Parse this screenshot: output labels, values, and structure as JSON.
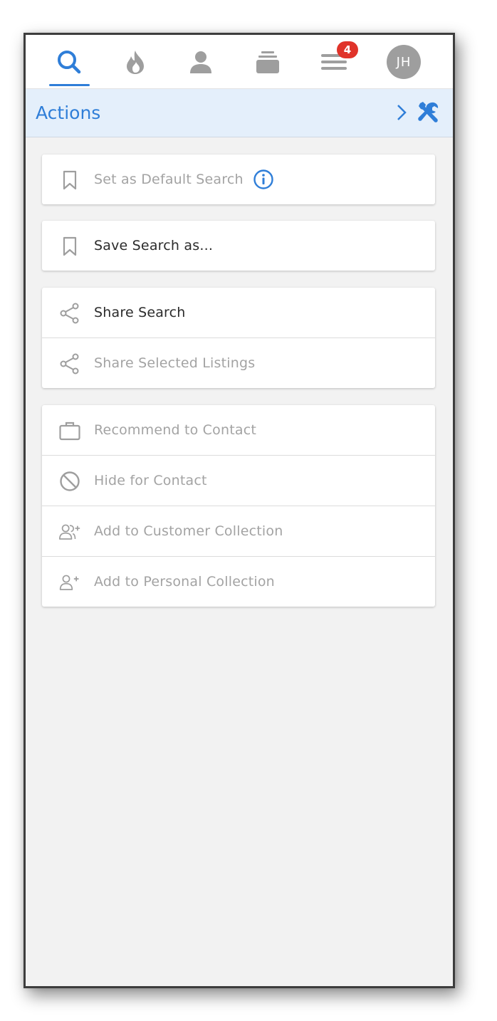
{
  "nav": {
    "items": [
      {
        "icon": "search-icon",
        "active": true
      },
      {
        "icon": "flame-icon"
      },
      {
        "icon": "person-icon"
      },
      {
        "icon": "stack-icon"
      },
      {
        "icon": "menu-icon",
        "badge": "4"
      },
      {
        "icon": "avatar",
        "initials": "JH"
      }
    ],
    "badge_count": "4",
    "avatar_initials": "JH"
  },
  "header": {
    "title": "Actions",
    "chevron_icon": "chevron-right-icon",
    "tools_icon": "tools-icon"
  },
  "groups": [
    {
      "rows": [
        {
          "label": "Set as Default Search",
          "icon": "bookmark-icon",
          "enabled": false,
          "extra_icon": "info-icon"
        }
      ]
    },
    {
      "rows": [
        {
          "label": "Save Search as...",
          "icon": "bookmark-icon",
          "enabled": true
        }
      ]
    },
    {
      "rows": [
        {
          "label": "Share Search",
          "icon": "share-icon",
          "enabled": true
        },
        {
          "label": "Share Selected Listings",
          "icon": "share-icon",
          "enabled": false
        }
      ]
    },
    {
      "rows": [
        {
          "label": "Recommend to Contact",
          "icon": "briefcase-icon",
          "enabled": false
        },
        {
          "label": "Hide for Contact",
          "icon": "block-icon",
          "enabled": false
        },
        {
          "label": "Add to Customer Collection",
          "icon": "add-users-icon",
          "enabled": false
        },
        {
          "label": "Add to Personal Collection",
          "icon": "add-user-icon",
          "enabled": false
        }
      ]
    }
  ],
  "colors": {
    "accent": "#2f7ed8",
    "badge": "#e0332a",
    "disabled_text": "#a3a3a3",
    "enabled_text": "#2b2b2b",
    "header_bg": "#e4effb"
  }
}
